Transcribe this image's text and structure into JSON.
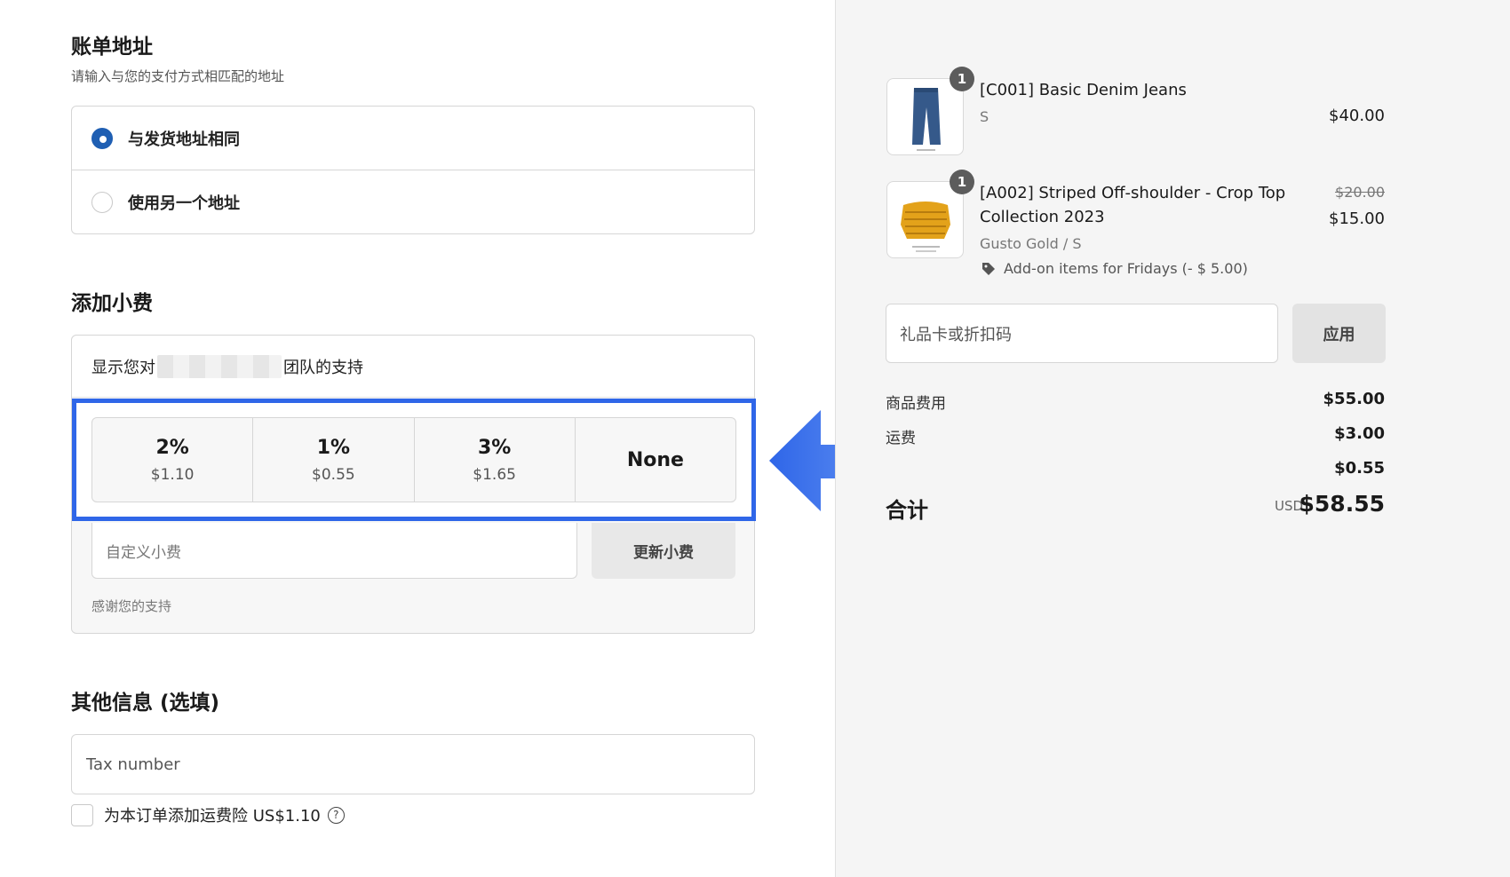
{
  "billing": {
    "title": "账单地址",
    "subtitle": "请输入与您的支付方式相匹配的地址",
    "options": [
      {
        "label": "与发货地址相同",
        "checked": true
      },
      {
        "label": "使用另一个地址",
        "checked": false
      }
    ]
  },
  "tip": {
    "title": "添加小费",
    "support_prefix": "显示您对",
    "support_suffix": "团队的支持",
    "options": [
      {
        "percent": "2%",
        "amount": "$1.10"
      },
      {
        "percent": "1%",
        "amount": "$0.55"
      },
      {
        "percent": "3%",
        "amount": "$1.65"
      }
    ],
    "none_label": "None",
    "custom_placeholder": "自定义小费",
    "update_label": "更新小费",
    "thanks": "感谢您的支持"
  },
  "extra": {
    "title": "其他信息 (选填)",
    "tax_placeholder": "Tax number",
    "insurance_label": "为本订单添加运费险 US$1.10",
    "help_glyph": "?"
  },
  "cart": {
    "items": [
      {
        "quantity": "1",
        "name": "[C001] Basic Denim Jeans",
        "variant": "S",
        "price": "$40.00"
      },
      {
        "quantity": "1",
        "name": "[A002] Striped Off-shoulder - Crop Top",
        "name_line2": "Collection 2023",
        "variant": "Gusto Gold / S",
        "old_price": "$20.00",
        "price": "$15.00",
        "discount": "Add-on items for Fridays (- $ 5.00)"
      }
    ],
    "gift_placeholder": "礼品卡或折扣码",
    "apply_label": "应用"
  },
  "summary": {
    "subtotal_label": "商品费用",
    "subtotal": "$55.00",
    "shipping_label": "运费",
    "shipping": "$3.00",
    "tip_value": "$0.55",
    "total_label": "合计",
    "currency": "USD",
    "total": "$58.55"
  },
  "colors": {
    "accent": "#2f66e8",
    "radio": "#1f5fb3"
  }
}
